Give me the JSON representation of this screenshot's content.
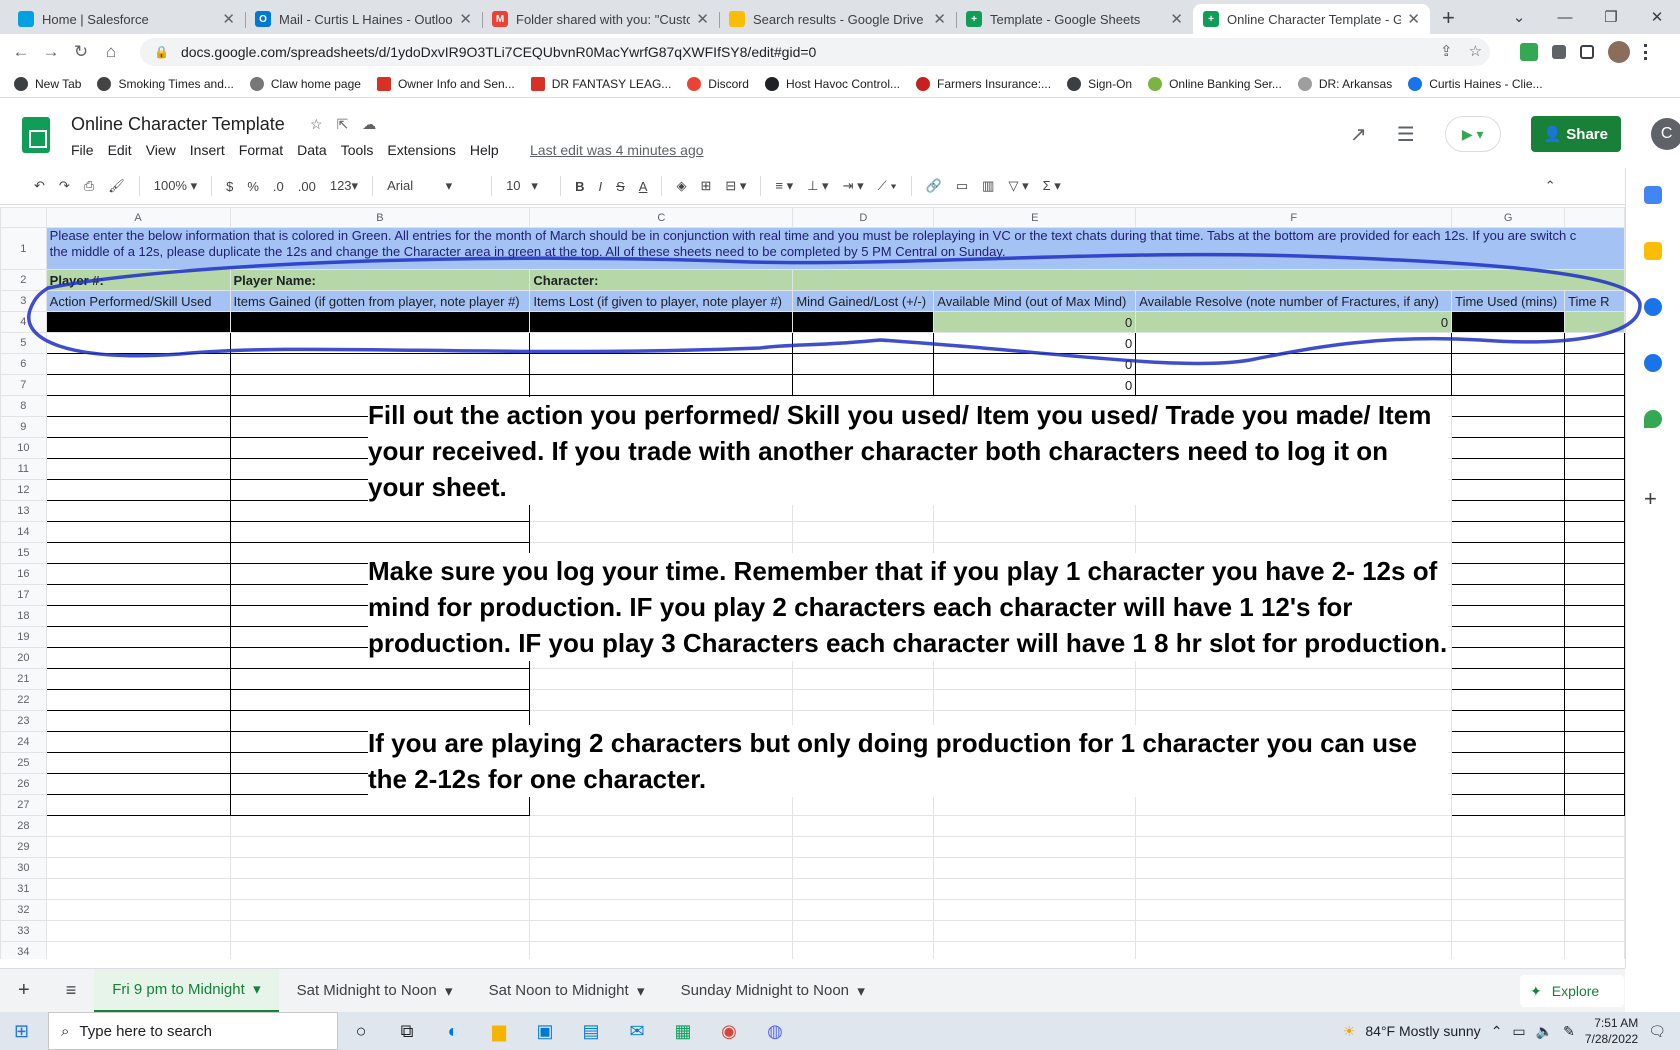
{
  "browser": {
    "tabs": [
      {
        "title": "Home | Salesforce",
        "color": "#00a1e0"
      },
      {
        "title": "Mail - Curtis L Haines - Outlook",
        "color": "#0078d4"
      },
      {
        "title": "Folder shared with you: \"Custom",
        "color": "#ea4335"
      },
      {
        "title": "Search results - Google Drive",
        "color": "#fbbc04"
      },
      {
        "title": "Template - Google Sheets",
        "color": "#0f9d58"
      },
      {
        "title": "Online Character Template - Go",
        "color": "#0f9d58"
      }
    ],
    "url": "docs.google.com/spreadsheets/d/1ydoDxvIR9O3TLi7CEQUbvnR0MacYwrfG87qXWFIfSY8/edit#gid=0",
    "bookmarks": [
      "New Tab",
      "Smoking Times and...",
      "Claw home page",
      "Owner Info and Sen...",
      "DR FANTASY LEAG...",
      "Discord",
      "Host Havoc Control...",
      "Farmers Insurance:...",
      "Sign-On",
      "Online Banking Ser...",
      "DR: Arkansas",
      "Curtis Haines - Clie..."
    ]
  },
  "doc": {
    "title": "Online Character Template",
    "menu": [
      "File",
      "Edit",
      "View",
      "Insert",
      "Format",
      "Data",
      "Tools",
      "Extensions",
      "Help"
    ],
    "last_edit": "Last edit was 4 minutes ago",
    "share": "Share",
    "avatar": "C"
  },
  "toolbar": {
    "zoom": "100%",
    "currency": "$",
    "percent": "%",
    "dec_less": ".0",
    "dec_more": ".00",
    "format": "123",
    "font": "Arial",
    "size": "10"
  },
  "columns": [
    "A",
    "B",
    "C",
    "D",
    "E",
    "F",
    "G",
    ""
  ],
  "rows": {
    "r1": "Please enter the below information that is colored in Green. All entries for the month of March should be in conjunction with real time and you must be roleplaying in VC or the text chats during that time. Tabs at the bottom are provided for each 12s. If you are switch c",
    "r1b": "the middle of a 12s, please duplicate the 12s and change the Character area in green at the top. All of these sheets need to be completed by 5 PM Central on Sunday.",
    "r2": {
      "a": "Player #:",
      "b": "Player Name:",
      "c": "Character:"
    },
    "r3": [
      "Action Performed/Skill Used",
      "Items Gained (if gotten from player, note player #)",
      "Items Lost (if given to player, note player #)",
      "Mind Gained/Lost (+/-)",
      "Available Mind (out of Max Mind)",
      "Available Resolve (note number of Fractures, if any)",
      "Time Used (mins)",
      "Time R"
    ],
    "zero": "0"
  },
  "instructions": {
    "p1": "Fill out the action you performed/ Skill you used/ Item you used/ Trade you made/ Item your received.  If you trade with another character both characters need to log it on your sheet.",
    "p2": "Make sure you log your time. Remember that if you play 1 character you have 2- 12s of mind for production. IF you play 2 characters each character will have 1 12's for production.  IF you play 3 Characters  each character will have 1 8 hr slot for production.",
    "p3": "If you are playing 2 characters but only doing production for 1 character you can use the 2-12s for one character."
  },
  "sheet_tabs": [
    "Fri 9 pm to Midnight",
    "Sat Midnight to Noon",
    "Sat Noon to Midnight",
    "Sunday Midnight to Noon"
  ],
  "explore": "Explore",
  "taskbar": {
    "search": "Type here to search",
    "weather": "84°F  Mostly sunny",
    "time": "7:51 AM",
    "date": "7/28/2022"
  }
}
